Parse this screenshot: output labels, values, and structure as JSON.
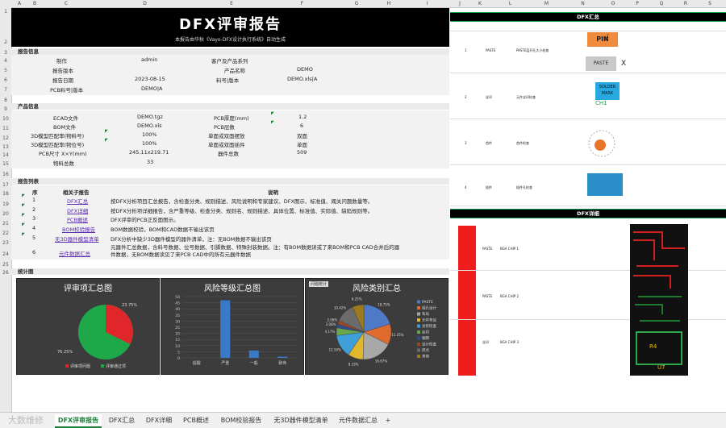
{
  "columns": [
    "A",
    "B",
    "C",
    "D",
    "E",
    "F",
    "G",
    "H",
    "I",
    "J",
    "K",
    "L",
    "M",
    "N",
    "O",
    "P",
    "Q",
    "R",
    "S"
  ],
  "rows": [
    "1",
    "2",
    "3",
    "4",
    "5",
    "6",
    "7",
    "8",
    "9",
    "10",
    "11",
    "12",
    "13",
    "14",
    "15",
    "16",
    "17",
    "18",
    "19",
    "20",
    "21",
    "22",
    "23",
    "24",
    "25",
    "26"
  ],
  "report": {
    "title": "DFX评审报告",
    "subtitle": "本报告由华秋《Vayo-DFX设计执行系统》自动生成",
    "section_info": "报告信息",
    "info": [
      {
        "label": "制作",
        "value": "admin",
        "label2": "客户及产品系列",
        "value2": ""
      },
      {
        "label": "报告版本",
        "value": "",
        "label2": "产品名称",
        "value2": "DEMO"
      },
      {
        "label": "报告日期",
        "value": "2023-08-15",
        "label2": "料号|版本",
        "value2": "DEMO.xls|A"
      },
      {
        "label": "PCB料号|版本",
        "value": "DEMO|A",
        "label2": "",
        "value2": ""
      }
    ],
    "section_product": "产品信息",
    "product": [
      {
        "label": "ECAD文件",
        "value": "DEMO.tgz",
        "label2": "PCB厚度(mm)",
        "value2": "1.2"
      },
      {
        "label": "BOM文件",
        "value": "DEMO.xls",
        "label2": "PCB层数",
        "value2": "6"
      },
      {
        "label": "3D模型匹配率(物料号)",
        "value": "100%",
        "label2": "单面或双面摆放",
        "value2": "双面"
      },
      {
        "label": "3D模型匹配率(物位号)",
        "value": "100%",
        "label2": "单面或双面插件",
        "value2": "单面"
      },
      {
        "label": "PCB尺寸 X×Y(mm)",
        "value": "245.11x219.71",
        "label2": "器件总数",
        "value2": "509"
      },
      {
        "label": "物料总数",
        "value": "33",
        "label2": "",
        "value2": ""
      }
    ],
    "section_list": "报告列表",
    "list_headers": {
      "no": "序",
      "name": "相关子报告",
      "desc": "说明"
    },
    "list": [
      {
        "no": "1",
        "name": "DFX汇总",
        "desc": "按DFX分析项目汇总报告，含检查分类、规则描述、风险说明和专家建议、DFX图示、标准值、阈关问题数量等。"
      },
      {
        "no": "2",
        "name": "DFX详细",
        "desc": "按DFX分析项详细报告，含严重等级、检查分类、规则名、规则描述、具体位置、标准值、实际值、缺陷规则等。"
      },
      {
        "no": "3",
        "name": "PCB概述",
        "desc": "DFX评审的PCB正反面图示。"
      },
      {
        "no": "4",
        "name": "BOM校验报告",
        "desc": "BOM数据校验，BOM和CAD数据不输出该页"
      },
      {
        "no": "5",
        "name": "无3D器件模型清单",
        "desc": "DFX分析中缺少3D器件模型的器件清单，注：无BOM数据不输出该页"
      },
      {
        "no": "6",
        "name": "元件数据汇总",
        "desc": "元器件汇总数据，含料号数据、位号数据、引脚数据、特殊封装数据。注：有BOM数据读或了来BOM和PCB CAD合并后的器件数据，无BOM数据读见了来PCB CAD中的所有元器件数据"
      }
    ],
    "section_chart": "统计图"
  },
  "charts": {
    "pie_title": "评审项汇总图",
    "pie_labels": [
      "23.75%",
      "76.25%"
    ],
    "pie_legend": [
      "评审项问题",
      "评审通过项"
    ],
    "bar_title": "风险等级汇总图",
    "bar_ticks": [
      "50",
      "45",
      "40",
      "35",
      "30",
      "25",
      "20",
      "15",
      "10",
      "5",
      "0"
    ],
    "bar_categories": [
      "提醒",
      "严重",
      "一般",
      "致命"
    ],
    "bar_values": [
      0,
      47,
      6,
      1
    ],
    "risk_title": "风险类别汇总",
    "risk_tag": "问题统计",
    "risk_labels": [
      "18.75%",
      "11.25%",
      "16.67%",
      "8.33%",
      "12.50%",
      "4.17%",
      "2.08%",
      "2.08%",
      "10.42%",
      "6.25%"
    ],
    "risk_legend": [
      "PASTE",
      "插孔设计",
      "布局",
      "元件布设",
      "封装检查",
      "丝印",
      "钢网",
      "设计检查",
      "焊点",
      "其他"
    ]
  },
  "right": {
    "dfx_summary": "DFX汇总",
    "dfx_detail": "DFX详细",
    "icons": {
      "pin": "PIN",
      "paste": "PASTE",
      "solder": "SOLDER MASK",
      "ch1": "CH1",
      "tick": "√",
      "cross": "X"
    },
    "rows": [
      {
        "a": "1",
        "b": "PASTE",
        "c": "PASTE层开孔大小检查"
      },
      {
        "a": "2",
        "b": "丝印",
        "c": "元件丝印检查"
      },
      {
        "a": "3",
        "b": "首件",
        "c": "首件检查"
      },
      {
        "a": "4",
        "b": "插件",
        "c": "插件孔检查"
      }
    ],
    "detail_rows": [
      {
        "a": "1",
        "b": "PASTE",
        "c": "BGA CHIP 1"
      },
      {
        "a": "2",
        "b": "PASTE",
        "c": "BGA CHIP 2"
      },
      {
        "a": "3",
        "b": "丝印",
        "c": "BGA CHIP 3"
      }
    ],
    "pcb_labels": [
      "R4",
      "U7"
    ]
  },
  "tabs": [
    "DFX评审报告",
    "DFX汇总",
    "DFX详细",
    "PCB概述",
    "BOM校验报告",
    "无3D器件模型清单",
    "元件数据汇总",
    "+"
  ],
  "watermark": "大数维修"
}
